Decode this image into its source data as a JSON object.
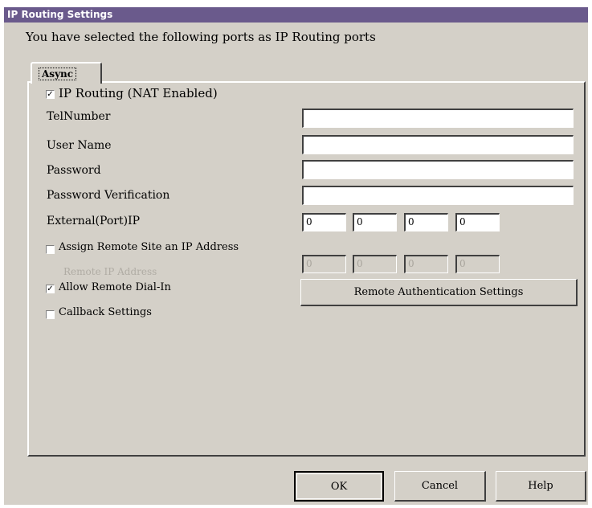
{
  "window": {
    "title": "IP Routing Settings"
  },
  "intro_text": "You have selected the following ports as IP Routing ports",
  "tabs": [
    {
      "label": "Async"
    }
  ],
  "form": {
    "ip_routing": {
      "label": "IP Routing (NAT Enabled)",
      "checked": true
    },
    "tel_number": {
      "label": "TelNumber",
      "value": ""
    },
    "user_name": {
      "label": "User Name",
      "value": ""
    },
    "password": {
      "label": "Password",
      "value": ""
    },
    "password_verification": {
      "label": "Password Verification",
      "value": ""
    },
    "external_ip": {
      "label": "External(Port)IP",
      "octets": [
        "0",
        "0",
        "0",
        "0"
      ]
    },
    "assign_remote": {
      "label": "Assign Remote Site an IP Address",
      "checked": false
    },
    "remote_ip": {
      "label": "Remote IP Address",
      "octets": [
        "0",
        "0",
        "0",
        "0"
      ],
      "disabled": true
    },
    "allow_dialin": {
      "label": "Allow Remote Dial-In",
      "checked": true
    },
    "remote_auth_button": "Remote Authentication Settings",
    "callback": {
      "label": "Callback Settings",
      "checked": false
    }
  },
  "buttons": {
    "ok": "OK",
    "cancel": "Cancel",
    "help": "Help"
  },
  "check_glyph": "✓"
}
